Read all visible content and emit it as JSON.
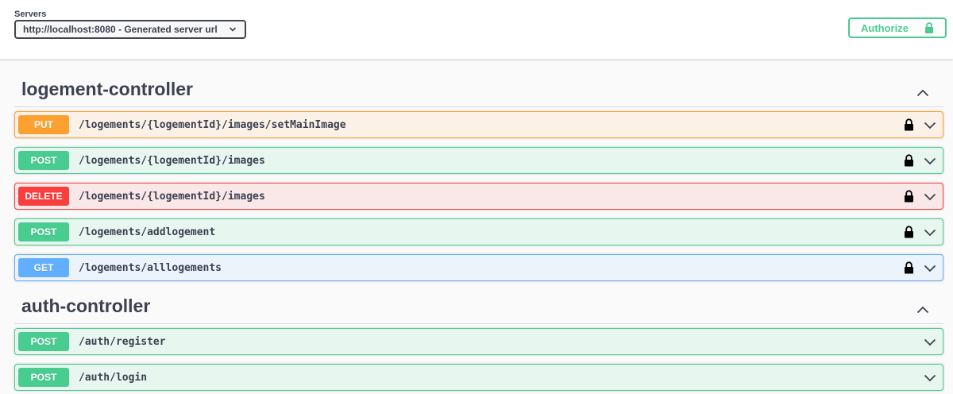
{
  "servers": {
    "label": "Servers",
    "selected": "http://localhost:8080 - Generated server url"
  },
  "authorize": {
    "label": "Authorize"
  },
  "tags": [
    {
      "name": "logement-controller",
      "operations": [
        {
          "method": "PUT",
          "path": "/logements/{logementId}/images/setMainImage",
          "locked": true
        },
        {
          "method": "POST",
          "path": "/logements/{logementId}/images",
          "locked": true
        },
        {
          "method": "DELETE",
          "path": "/logements/{logementId}/images",
          "locked": true
        },
        {
          "method": "POST",
          "path": "/logements/addlogement",
          "locked": true
        },
        {
          "method": "GET",
          "path": "/logements/alllogements",
          "locked": true
        }
      ]
    },
    {
      "name": "auth-controller",
      "operations": [
        {
          "method": "POST",
          "path": "/auth/register",
          "locked": false
        },
        {
          "method": "POST",
          "path": "/auth/login",
          "locked": false
        }
      ]
    }
  ],
  "colors": {
    "put": "#fca130",
    "post": "#49cc90",
    "delete": "#f93e3e",
    "get": "#61affe",
    "text": "#3b4151"
  },
  "icons": {
    "lock": "lock-icon",
    "chevron": "chevron-down-icon",
    "collapse": "chevron-up-icon"
  }
}
